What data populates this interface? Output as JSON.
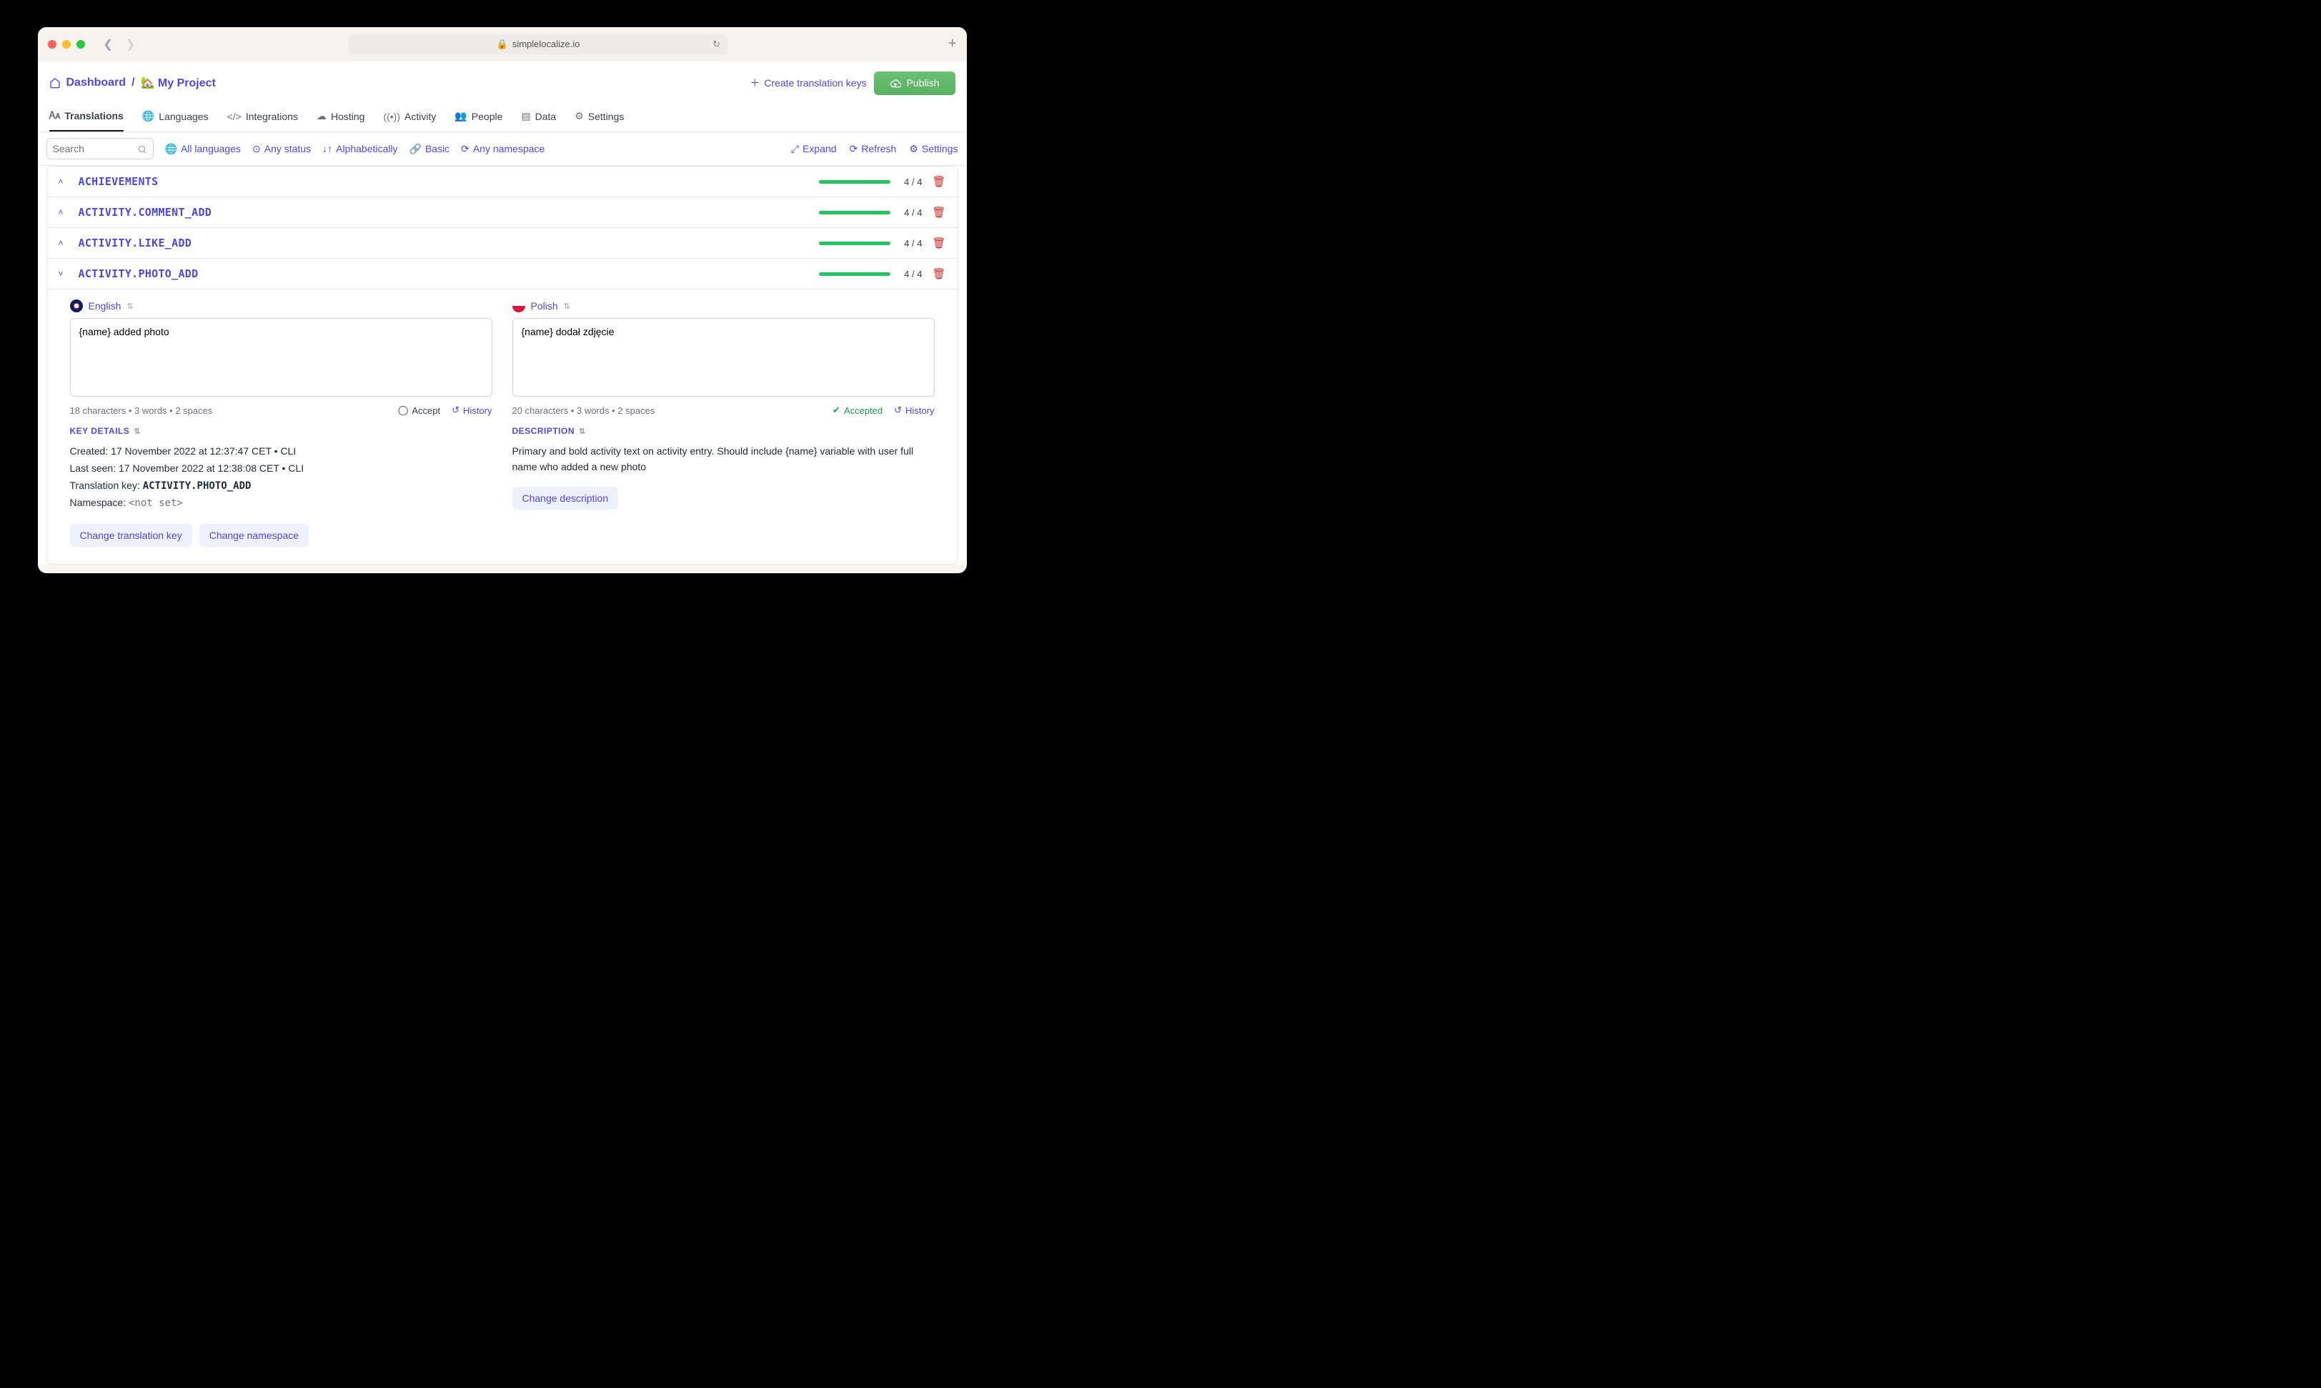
{
  "browser": {
    "url": "simplelocalize.io"
  },
  "breadcrumb": {
    "dashboard": "Dashboard",
    "project": "🏡 My Project"
  },
  "actions": {
    "create_keys": "Create translation keys",
    "publish": "Publish"
  },
  "tabs": [
    {
      "label": "Translations",
      "icon": "translate-icon",
      "active": true
    },
    {
      "label": "Languages",
      "icon": "globe-icon"
    },
    {
      "label": "Integrations",
      "icon": "code-icon"
    },
    {
      "label": "Hosting",
      "icon": "cloud-icon"
    },
    {
      "label": "Activity",
      "icon": "activity-icon"
    },
    {
      "label": "People",
      "icon": "people-icon"
    },
    {
      "label": "Data",
      "icon": "data-icon"
    },
    {
      "label": "Settings",
      "icon": "gear-icon"
    }
  ],
  "filters": {
    "search_placeholder": "Search",
    "all_languages": "All languages",
    "any_status": "Any status",
    "alphabetically": "Alphabetically",
    "basic": "Basic",
    "any_namespace": "Any namespace",
    "expand": "Expand",
    "refresh": "Refresh",
    "settings": "Settings"
  },
  "keys": [
    {
      "name": "ACHIEVEMENTS",
      "count": "4 / 4",
      "expanded": false
    },
    {
      "name": "ACTIVITY.COMMENT_ADD",
      "count": "4 / 4",
      "expanded": false
    },
    {
      "name": "ACTIVITY.LIKE_ADD",
      "count": "4 / 4",
      "expanded": false
    },
    {
      "name": "ACTIVITY.PHOTO_ADD",
      "count": "4 / 4",
      "expanded": true
    }
  ],
  "editor": {
    "english": {
      "label": "English",
      "text": "{name} added photo",
      "stats": "18 characters  •  3 words  •  2 spaces",
      "accept": "Accept",
      "history": "History"
    },
    "polish": {
      "label": "Polish",
      "text": "{name} dodał zdjęcie",
      "stats": "20 characters  •  3 words  •  2 spaces",
      "accepted": "Accepted",
      "history": "History"
    },
    "key_details": {
      "title": "KEY DETAILS",
      "created_label": "Created:",
      "created_value": "17 November 2022 at 12:37:47 CET  •  CLI",
      "lastseen_label": "Last seen:",
      "lastseen_value": "17 November 2022 at 12:38:08 CET  •  CLI",
      "tk_label": "Translation key:",
      "tk_value": "ACTIVITY.PHOTO_ADD",
      "ns_label": "Namespace:",
      "ns_value": "<not set>",
      "change_key": "Change translation key",
      "change_ns": "Change namespace"
    },
    "description": {
      "title": "DESCRIPTION",
      "text": "Primary and bold activity text on activity entry. Should include {name} variable with user full name who added a new photo",
      "change": "Change description"
    }
  }
}
